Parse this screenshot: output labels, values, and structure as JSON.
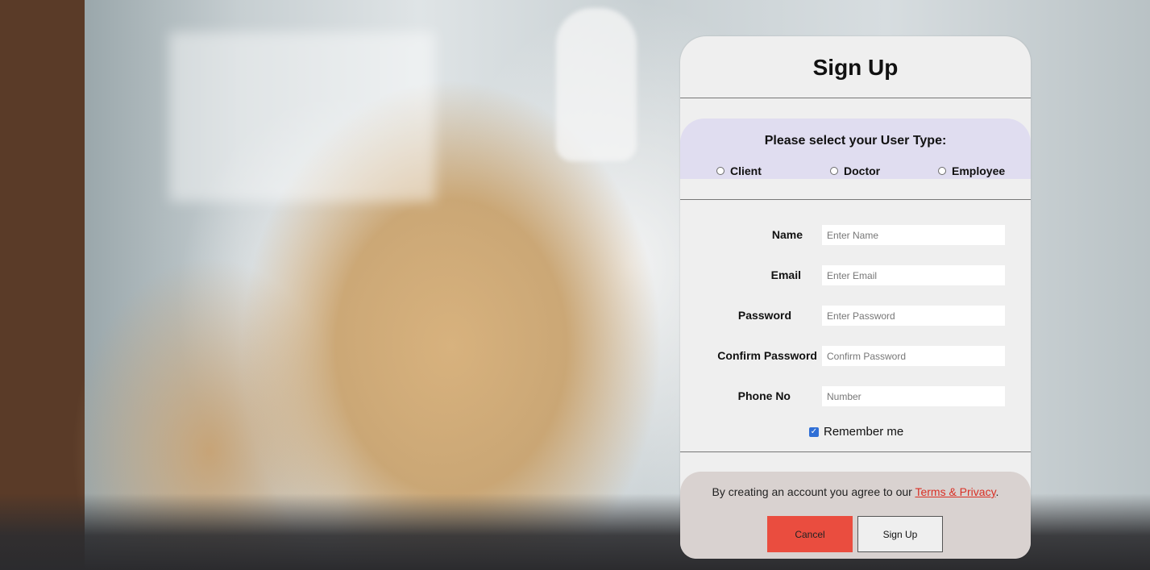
{
  "form": {
    "title": "Sign Up",
    "user_type": {
      "prompt": "Please select your User Type:",
      "options": [
        "Client",
        "Doctor",
        "Employee"
      ],
      "selected": null
    },
    "fields": [
      {
        "label": "Name",
        "placeholder": "Enter Name",
        "value": ""
      },
      {
        "label": "Email",
        "placeholder": "Enter Email",
        "value": ""
      },
      {
        "label": "Password",
        "placeholder": "Enter Password",
        "value": ""
      },
      {
        "label": "Confirm Password",
        "placeholder": "Confirm Password",
        "value": ""
      },
      {
        "label": "Phone No",
        "placeholder": "Number",
        "value": ""
      }
    ],
    "remember_me": {
      "label": "Remember me",
      "checked": true
    },
    "terms": {
      "prefix": "By creating an account you agree to our ",
      "link_text": "Terms & Privacy",
      "suffix": "."
    },
    "buttons": {
      "cancel": "Cancel",
      "signup": "Sign Up"
    }
  },
  "colors": {
    "card_bg": "#efefef",
    "usertype_bg": "#e0ddf0",
    "footer_bg": "#d9d2d0",
    "cancel_button": "#ea4d3f",
    "link": "#d93025",
    "checkbox": "#2f6fd6"
  }
}
